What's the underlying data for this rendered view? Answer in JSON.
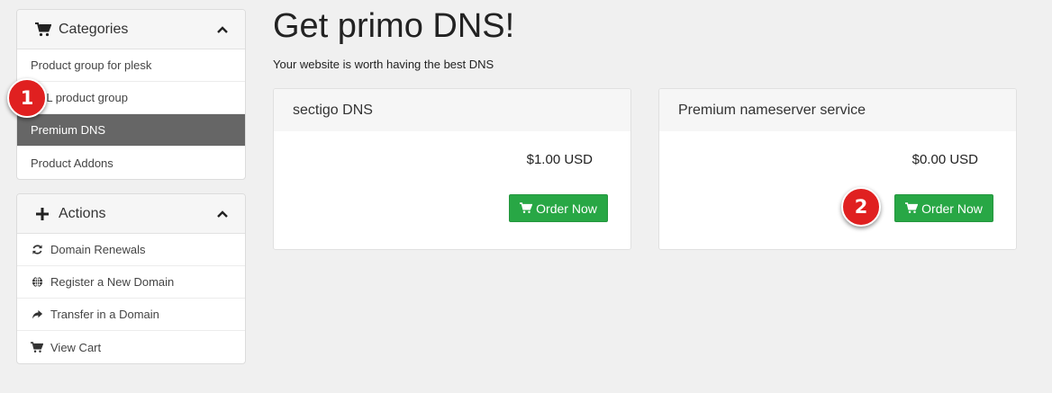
{
  "sidebar": {
    "categories": {
      "title": "Categories",
      "items": [
        {
          "label": "Product group for plesk",
          "active": false
        },
        {
          "label": "SSL product group",
          "active": false
        },
        {
          "label": "Premium DNS",
          "active": true
        },
        {
          "label": "Product Addons",
          "active": false
        }
      ]
    },
    "actions": {
      "title": "Actions",
      "items": [
        {
          "label": "Domain Renewals",
          "icon": "refresh-icon"
        },
        {
          "label": "Register a New Domain",
          "icon": "globe-icon"
        },
        {
          "label": "Transfer in a Domain",
          "icon": "share-icon"
        },
        {
          "label": "View Cart",
          "icon": "cart-icon"
        }
      ]
    }
  },
  "main": {
    "title": "Get primo DNS!",
    "tagline": "Your website is worth having the best DNS",
    "products": [
      {
        "name": "sectigo DNS",
        "price": "$1.00 USD",
        "button": "Order Now"
      },
      {
        "name": "Premium nameserver service",
        "price": "$0.00 USD",
        "button": "Order Now"
      }
    ]
  },
  "markers": [
    "1",
    "2"
  ],
  "colors": {
    "accent_button": "#28a745",
    "active_item": "#666666",
    "marker": "#e02020"
  }
}
